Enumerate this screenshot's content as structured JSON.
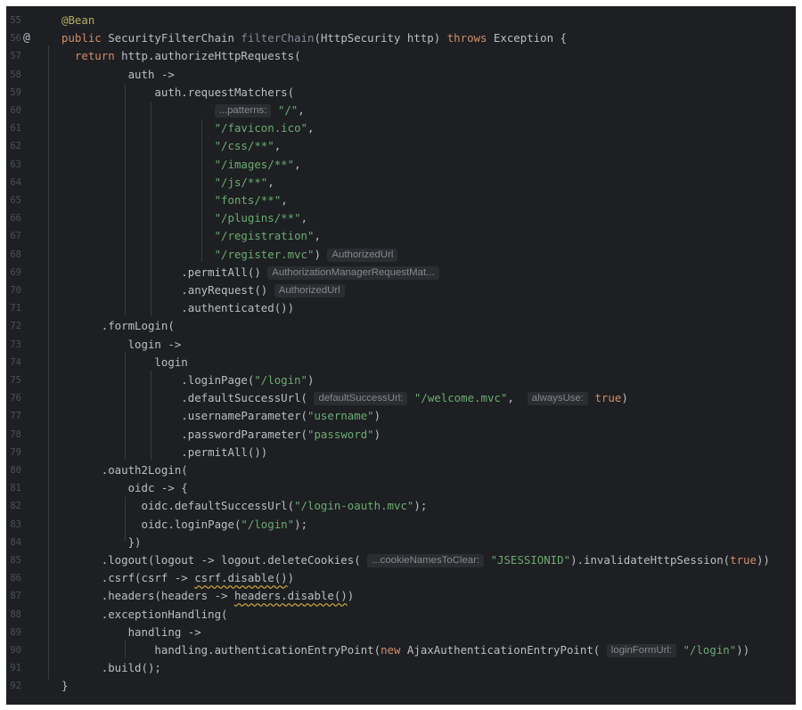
{
  "editor": {
    "gutter_marker": "@",
    "lines": [
      {
        "num": "55",
        "segments": [
          [
            "ann",
            "@Bean"
          ]
        ]
      },
      {
        "num": "56",
        "marker": true,
        "segments": [
          [
            "kw",
            "public "
          ],
          [
            "t",
            "SecurityFilterChain "
          ],
          [
            "fn",
            "filterChain"
          ],
          [
            "t",
            "(HttpSecurity http) "
          ],
          [
            "kw",
            "throws "
          ],
          [
            "t",
            "Exception {"
          ]
        ]
      },
      {
        "num": "57",
        "segments": [
          [
            "t",
            "  "
          ],
          [
            "kw",
            "return "
          ],
          [
            "t",
            "http.authorizeHttpRequests("
          ]
        ]
      },
      {
        "num": "58",
        "segments": [
          [
            "t",
            "          auth ->"
          ]
        ]
      },
      {
        "num": "59",
        "segments": [
          [
            "t",
            "              auth.requestMatchers("
          ]
        ]
      },
      {
        "num": "60",
        "segments": [
          [
            "t",
            "                       "
          ],
          [
            "hint",
            "...patterns:"
          ],
          [
            "t",
            " "
          ],
          [
            "str",
            "\"/\""
          ],
          [
            "t",
            ","
          ]
        ]
      },
      {
        "num": "61",
        "segments": [
          [
            "t",
            "                       "
          ],
          [
            "str",
            "\"/favicon.ico\""
          ],
          [
            "t",
            ","
          ]
        ]
      },
      {
        "num": "62",
        "segments": [
          [
            "t",
            "                       "
          ],
          [
            "str",
            "\"/css/**\""
          ],
          [
            "t",
            ","
          ]
        ]
      },
      {
        "num": "63",
        "segments": [
          [
            "t",
            "                       "
          ],
          [
            "str",
            "\"/images/**\""
          ],
          [
            "t",
            ","
          ]
        ]
      },
      {
        "num": "64",
        "segments": [
          [
            "t",
            "                       "
          ],
          [
            "str",
            "\"/js/**\""
          ],
          [
            "t",
            ","
          ]
        ]
      },
      {
        "num": "65",
        "segments": [
          [
            "t",
            "                       "
          ],
          [
            "str",
            "\"fonts/**\""
          ],
          [
            "t",
            ","
          ]
        ]
      },
      {
        "num": "66",
        "segments": [
          [
            "t",
            "                       "
          ],
          [
            "str",
            "\"/plugins/**\""
          ],
          [
            "t",
            ","
          ]
        ]
      },
      {
        "num": "67",
        "segments": [
          [
            "t",
            "                       "
          ],
          [
            "str",
            "\"/registration\""
          ],
          [
            "t",
            ","
          ]
        ]
      },
      {
        "num": "68",
        "segments": [
          [
            "t",
            "                       "
          ],
          [
            "str",
            "\"/register.mvc\""
          ],
          [
            "t",
            ") "
          ],
          [
            "hint",
            "AuthorizedUrl"
          ]
        ]
      },
      {
        "num": "69",
        "segments": [
          [
            "t",
            "                  .permitAll() "
          ],
          [
            "hint",
            "AuthorizationManagerRequestMat..."
          ]
        ]
      },
      {
        "num": "70",
        "segments": [
          [
            "t",
            "                  .anyRequest() "
          ],
          [
            "hint",
            "AuthorizedUrl"
          ]
        ]
      },
      {
        "num": "71",
        "segments": [
          [
            "t",
            "                  .authenticated())"
          ]
        ]
      },
      {
        "num": "72",
        "segments": [
          [
            "t",
            "      .formLogin("
          ]
        ]
      },
      {
        "num": "73",
        "segments": [
          [
            "t",
            "          login ->"
          ]
        ]
      },
      {
        "num": "74",
        "segments": [
          [
            "t",
            "              login"
          ]
        ]
      },
      {
        "num": "75",
        "segments": [
          [
            "t",
            "                  .loginPage("
          ],
          [
            "str",
            "\"/login\""
          ],
          [
            "t",
            ")"
          ]
        ]
      },
      {
        "num": "76",
        "segments": [
          [
            "t",
            "                  .defaultSuccessUrl( "
          ],
          [
            "hint",
            "defaultSuccessUrl:"
          ],
          [
            "t",
            " "
          ],
          [
            "str",
            "\"/welcome.mvc\""
          ],
          [
            "t",
            ",  "
          ],
          [
            "hint",
            "alwaysUse:"
          ],
          [
            "t",
            " "
          ],
          [
            "kw",
            "true"
          ],
          [
            "t",
            ")"
          ]
        ]
      },
      {
        "num": "77",
        "segments": [
          [
            "t",
            "                  .usernameParameter("
          ],
          [
            "str",
            "\"username\""
          ],
          [
            "t",
            ")"
          ]
        ]
      },
      {
        "num": "78",
        "segments": [
          [
            "t",
            "                  .passwordParameter("
          ],
          [
            "str",
            "\"password\""
          ],
          [
            "t",
            ")"
          ]
        ]
      },
      {
        "num": "79",
        "segments": [
          [
            "t",
            "                  .permitAll())"
          ]
        ]
      },
      {
        "num": "80",
        "segments": [
          [
            "t",
            "      .oauth2Login("
          ]
        ]
      },
      {
        "num": "81",
        "segments": [
          [
            "t",
            "          oidc -> {"
          ]
        ]
      },
      {
        "num": "82",
        "segments": [
          [
            "t",
            "            oidc.defaultSuccessUrl("
          ],
          [
            "str",
            "\"/login-oauth.mvc\""
          ],
          [
            "t",
            ");"
          ]
        ]
      },
      {
        "num": "83",
        "segments": [
          [
            "t",
            "            oidc.loginPage("
          ],
          [
            "str",
            "\"/login\""
          ],
          [
            "t",
            ");"
          ]
        ]
      },
      {
        "num": "84",
        "segments": [
          [
            "t",
            "          })"
          ]
        ]
      },
      {
        "num": "85",
        "segments": [
          [
            "t",
            "      .logout(logout -> logout.deleteCookies( "
          ],
          [
            "hint",
            "...cookieNamesToClear:"
          ],
          [
            "t",
            " "
          ],
          [
            "str",
            "\"JSESSIONID\""
          ],
          [
            "t",
            ").invalidateHttpSession("
          ],
          [
            "kw",
            "true"
          ],
          [
            "t",
            "))"
          ]
        ]
      },
      {
        "num": "86",
        "segments": [
          [
            "t",
            "      .csrf(csrf -> "
          ],
          [
            "sq",
            "csrf.disable()"
          ],
          [
            "t",
            ")"
          ]
        ]
      },
      {
        "num": "87",
        "segments": [
          [
            "t",
            "      .headers(headers -> "
          ],
          [
            "sq",
            "headers.disable()"
          ],
          [
            "t",
            ")"
          ]
        ]
      },
      {
        "num": "88",
        "segments": [
          [
            "t",
            "      .exceptionHandling("
          ]
        ]
      },
      {
        "num": "89",
        "segments": [
          [
            "t",
            "          handling ->"
          ]
        ]
      },
      {
        "num": "90",
        "segments": [
          [
            "t",
            "              handling.authenticationEntryPoint("
          ],
          [
            "kw",
            "new "
          ],
          [
            "t",
            "AjaxAuthenticationEntryPoint( "
          ],
          [
            "hint",
            "loginFormUrl:"
          ],
          [
            "t",
            " "
          ],
          [
            "str",
            "\"/login\""
          ],
          [
            "t",
            "))"
          ]
        ]
      },
      {
        "num": "91",
        "segments": [
          [
            "t",
            "      .build();"
          ]
        ]
      },
      {
        "num": "92",
        "segments": [
          [
            "t",
            "}"
          ]
        ]
      }
    ]
  }
}
